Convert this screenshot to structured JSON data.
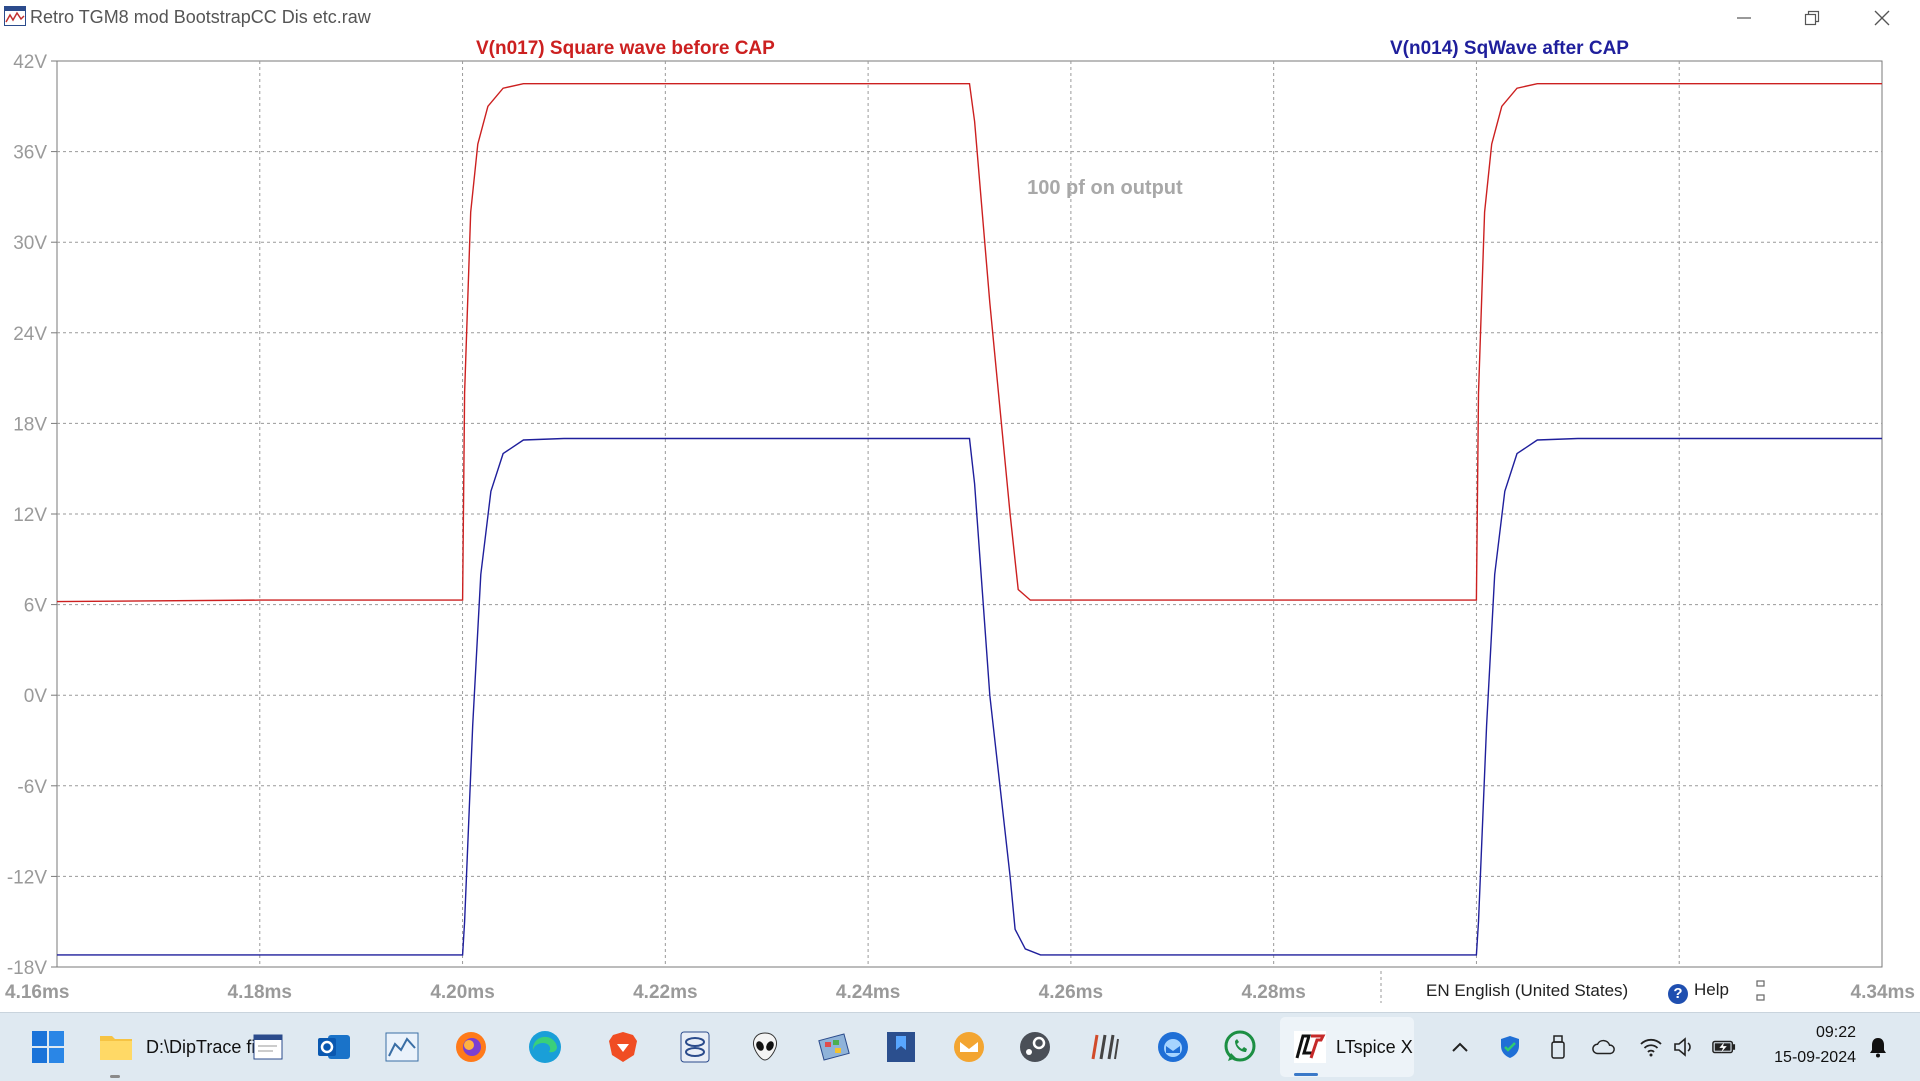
{
  "window": {
    "title": "Retro TGM8 mod BootstrapCC Dis etc.raw",
    "controls": [
      "minimize-icon",
      "restore-icon",
      "close-icon"
    ]
  },
  "chart_data": {
    "type": "line",
    "xlabel": "",
    "ylabel": "",
    "xlim": [
      4.16,
      4.34
    ],
    "ylim": [
      -18,
      42
    ],
    "grid": true,
    "x_ticks": [
      "4.16ms",
      "4.18ms",
      "4.20ms",
      "4.22ms",
      "4.24ms",
      "4.26ms",
      "4.28ms",
      "4.30ms",
      "4.32ms",
      "4.34ms"
    ],
    "x_tick_values": [
      4.16,
      4.18,
      4.2,
      4.22,
      4.24,
      4.26,
      4.28,
      4.3,
      4.32,
      4.34
    ],
    "y_ticks": [
      "42V",
      "36V",
      "30V",
      "24V",
      "18V",
      "12V",
      "6V",
      "0V",
      "-6V",
      "-12V",
      "-18V"
    ],
    "y_tick_values": [
      42,
      36,
      30,
      24,
      18,
      12,
      6,
      0,
      -6,
      -12,
      -18
    ],
    "series": [
      {
        "name": "V(n017)   Square wave before CAP",
        "color": "#cc2020",
        "x": [
          4.16,
          4.18,
          4.2,
          4.2002,
          4.2008,
          4.2015,
          4.2025,
          4.204,
          4.206,
          4.21,
          4.25,
          4.2505,
          4.252,
          4.254,
          4.2548,
          4.256,
          4.26,
          4.28,
          4.3,
          4.3002,
          4.3008,
          4.3015,
          4.3025,
          4.304,
          4.306,
          4.31,
          4.34
        ],
        "y": [
          6.2,
          6.3,
          6.3,
          20,
          32,
          36.5,
          39,
          40.2,
          40.5,
          40.5,
          40.5,
          38,
          26,
          12,
          7,
          6.3,
          6.3,
          6.3,
          6.3,
          20,
          32,
          36.5,
          39,
          40.2,
          40.5,
          40.5,
          40.5
        ]
      },
      {
        "name": "V(n014)  SqWave after CAP",
        "color": "#1f1f9c",
        "x": [
          4.16,
          4.18,
          4.2,
          4.2002,
          4.201,
          4.2018,
          4.2028,
          4.204,
          4.206,
          4.21,
          4.25,
          4.2505,
          4.252,
          4.254,
          4.2545,
          4.2555,
          4.257,
          4.26,
          4.28,
          4.3,
          4.3002,
          4.301,
          4.3018,
          4.3028,
          4.304,
          4.306,
          4.31,
          4.34
        ],
        "y": [
          -17.2,
          -17.2,
          -17.2,
          -15,
          -2,
          8,
          13.5,
          16,
          16.9,
          17,
          17,
          14,
          0,
          -12,
          -15.5,
          -16.8,
          -17.2,
          -17.2,
          -17.2,
          -17.2,
          -15,
          -2,
          8,
          13.5,
          16,
          16.9,
          17,
          17
        ]
      }
    ],
    "annotations": [
      {
        "text": "100 pf on output",
        "x": 4.2545,
        "y": 33.2
      }
    ]
  },
  "status": {
    "language": "EN English (United States)",
    "help_label": "Help",
    "help_icon": "?"
  },
  "taskbar": {
    "items": [
      {
        "name": "start-icon",
        "label": ""
      },
      {
        "name": "file-explorer-icon",
        "label": "D:\\DipTrace file"
      },
      {
        "name": "outlook-icon",
        "label": ""
      },
      {
        "name": "chart-app-icon",
        "label": ""
      },
      {
        "name": "firefox-icon",
        "label": ""
      },
      {
        "name": "edge-icon",
        "label": ""
      },
      {
        "name": "brave-icon",
        "label": ""
      },
      {
        "name": "app-icon",
        "label": ""
      },
      {
        "name": "alien-icon",
        "label": ""
      },
      {
        "name": "control-panel-icon",
        "label": ""
      },
      {
        "name": "bookmark-icon",
        "label": ""
      },
      {
        "name": "mail-app-icon",
        "label": ""
      },
      {
        "name": "steam-icon",
        "label": ""
      },
      {
        "name": "tool-icon",
        "label": ""
      },
      {
        "name": "thunderbird-icon",
        "label": ""
      },
      {
        "name": "whatsapp-icon",
        "label": ""
      },
      {
        "name": "ltspice-icon",
        "label": "LTspice X"
      }
    ],
    "clock_time": "09:22",
    "clock_date": "15-09-2024"
  }
}
